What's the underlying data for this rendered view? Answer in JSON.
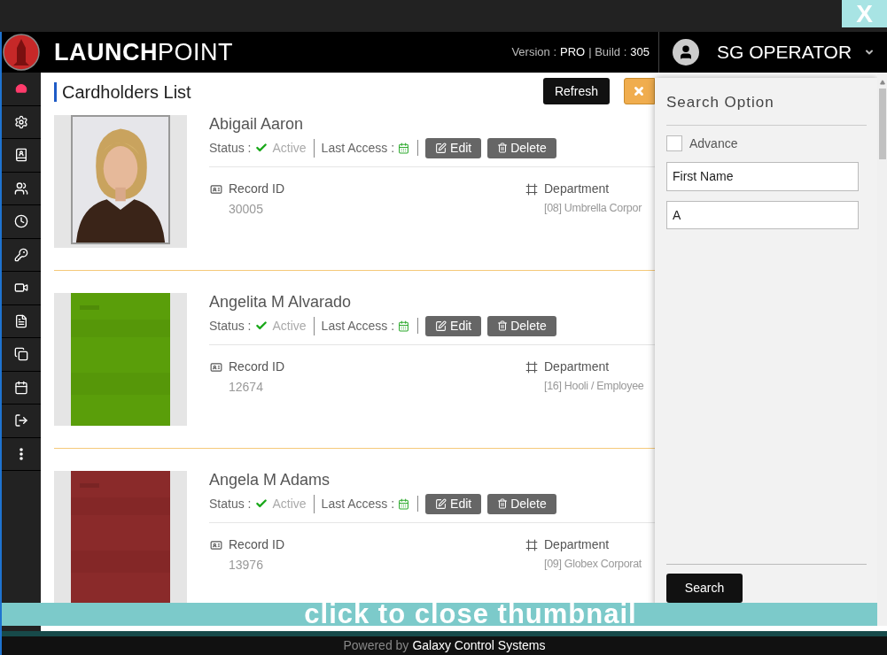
{
  "lightbox": {
    "close_label": "X",
    "overlay_text": "click to close thumbnail"
  },
  "header": {
    "brand": "**LAUNCH**POINT",
    "version_label": "Version :",
    "version": "PRO",
    "build_label": "| Build :",
    "build": "305",
    "user": "SG OPERATOR"
  },
  "sidebar": {
    "items": [
      {
        "selected": true
      },
      {
        "selected": false
      },
      {
        "selected": false
      },
      {
        "selected": false
      },
      {
        "selected": false
      },
      {
        "selected": false
      },
      {
        "selected": false
      },
      {
        "selected": false
      },
      {
        "selected": false
      },
      {
        "selected": false
      },
      {
        "selected": false
      },
      {
        "selected": false
      }
    ]
  },
  "page": {
    "title": "Cardholders List",
    "refresh": "Refresh"
  },
  "cardholders": [
    {
      "name": "Abigail Aaron",
      "status_label": "Status :",
      "status": "Active",
      "last_access_label": "Last Access :",
      "edit": "Edit",
      "delete": "Delete",
      "record_label": "Record ID",
      "record_id": "30005",
      "department_label": "Department",
      "department": "[08] Umbrella Corpor"
    },
    {
      "name": "Angelita M Alvarado",
      "status_label": "Status :",
      "status": "Active",
      "last_access_label": "Last Access :",
      "edit": "Edit",
      "delete": "Delete",
      "record_label": "Record ID",
      "record_id": "12674",
      "department_label": "Department",
      "department": "[16] Hooli / Employee"
    },
    {
      "name": "Angela M Adams",
      "status_label": "Status :",
      "status": "Active",
      "last_access_label": "Last Access :",
      "edit": "Edit",
      "delete": "Delete",
      "record_label": "Record ID",
      "record_id": "13976",
      "department_label": "Department",
      "department": "[09] Globex Corporat"
    }
  ],
  "search_panel": {
    "title": "Search Option",
    "advance": {
      "label": "Advance",
      "checked": false
    },
    "field": {
      "value": "First Name"
    },
    "query": {
      "value": "A"
    },
    "button": "Search"
  },
  "footer": {
    "prefix": "Powered by",
    "company": "Galaxy Control Systems"
  }
}
